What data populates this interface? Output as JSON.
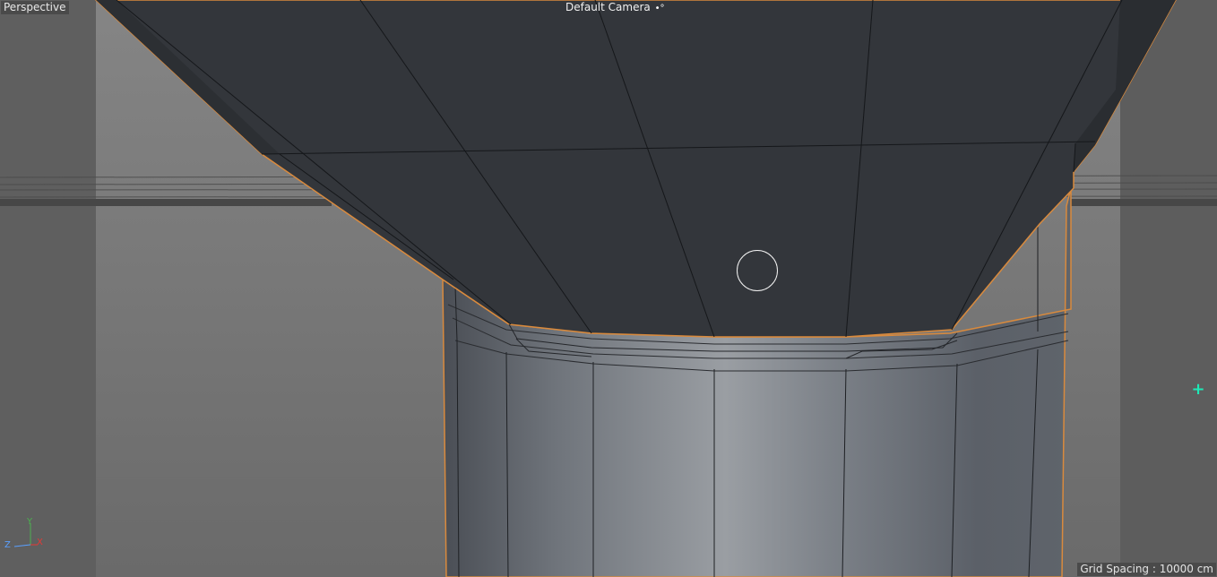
{
  "viewport": {
    "view_name": "Perspective",
    "camera_label": "Default Camera",
    "camera_icon": "camera-icon",
    "grid_spacing": "Grid Spacing : 10000 cm"
  },
  "axis_gizmo": {
    "y_label": "Y",
    "z_label": "Z",
    "x_label": "X",
    "colors": {
      "y": "#4caf50",
      "x": "#e53935",
      "z": "#5aa0ff"
    }
  },
  "colors": {
    "selection_outline": "#d98a3d",
    "add_cursor": "#1de9b6",
    "mesh_dark": "#33363b",
    "mesh_light": "#8b9096"
  }
}
